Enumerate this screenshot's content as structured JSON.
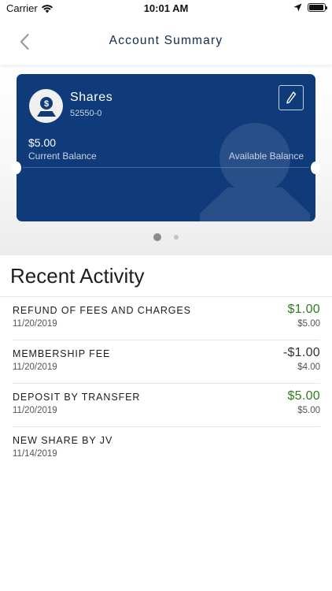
{
  "status_bar": {
    "carrier": "Carrier",
    "time": "10:01 AM",
    "icons": [
      "wifi-icon",
      "location-arrow-icon",
      "battery-icon"
    ],
    "battery_level": 0.95
  },
  "nav": {
    "title": "Account Summary",
    "back_icon": "chevron-left-icon"
  },
  "account_card": {
    "name": "Shares",
    "number": "52550-0",
    "current_balance": "$5.00",
    "current_balance_label": "Current Balance",
    "available_balance_label": "Available Balance",
    "icon": "money-hand-icon",
    "edit_icon": "pencil-icon",
    "color": "#0f3b7a"
  },
  "pager": {
    "count": 2,
    "active_index": 0
  },
  "activity": {
    "title": "Recent Activity",
    "items": [
      {
        "description": "REFUND OF FEES AND CHARGES",
        "date": "11/20/2019",
        "amount": "$1.00",
        "balance": "$5.00",
        "type": "credit"
      },
      {
        "description": "MEMBERSHIP FEE",
        "date": "11/20/2019",
        "amount": "-$1.00",
        "balance": "$4.00",
        "type": "debit"
      },
      {
        "description": "DEPOSIT BY TRANSFER",
        "date": "11/20/2019",
        "amount": "$5.00",
        "balance": "$5.00",
        "type": "credit"
      },
      {
        "description": "NEW SHARE BY JV",
        "date": "11/14/2019",
        "amount": "",
        "balance": "",
        "type": "none"
      }
    ]
  },
  "colors": {
    "credit": "#2f7d1e",
    "brand": "#0f3b7a",
    "title": "#0f2a4f"
  }
}
